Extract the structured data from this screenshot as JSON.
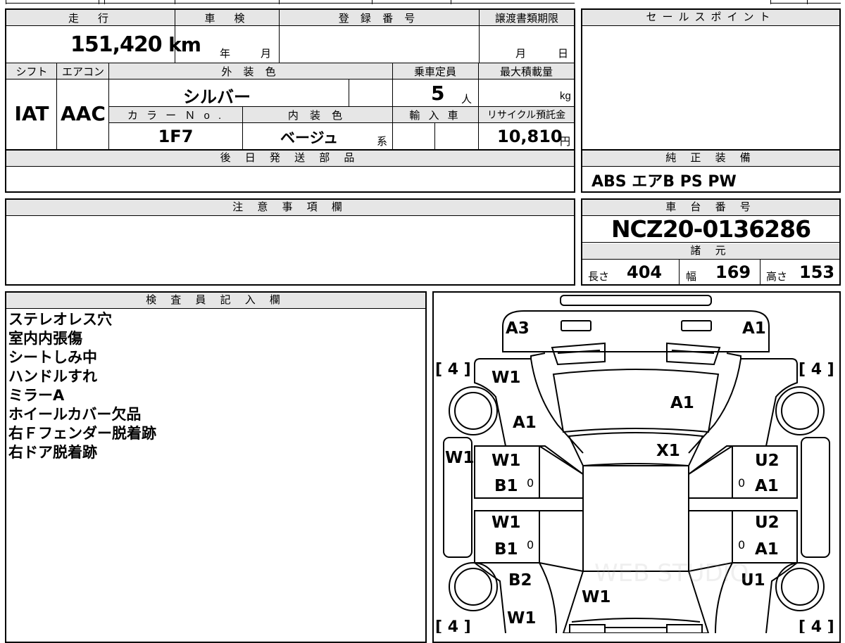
{
  "top_fields": {
    "mileage_label": "走　行",
    "mileage_value": "151,420",
    "mileage_unit": "km",
    "inspection_label": "車　検",
    "inspection_year": "年",
    "inspection_month": "月",
    "registration_label": "登 録 番 号",
    "transfer_label": "譲渡書類期限",
    "transfer_month": "月",
    "transfer_day": "日"
  },
  "row2": {
    "shift_label": "シフト",
    "shift_value": "IAT",
    "aircon_label": "エアコン",
    "aircon_value": "AAC",
    "exterior_label": "外 装 色",
    "exterior_value": "シルバー",
    "capacity_label": "乗車定員",
    "capacity_value": "5",
    "capacity_unit": "人",
    "load_label": "最大積載量",
    "load_unit": "kg",
    "color_no_label": "カ ラ ー Ｎ o .",
    "color_no_value": "1F7",
    "interior_label": "内 装 色",
    "interior_value": "ベージュ",
    "interior_suffix": "系",
    "import_label": "輸 入 車",
    "recycle_label": "リサイクル預託金",
    "recycle_value": "10,810",
    "recycle_unit": "円"
  },
  "later_parts": {
    "label": "後 日 発 送 部 品",
    "value": ""
  },
  "sales_point": {
    "label": "セールスポイント",
    "value": ""
  },
  "genuine_equipment": {
    "label": "純 正 装 備",
    "value": "ABS エアB PS PW"
  },
  "caution": {
    "label": "注 意 事 項 欄",
    "value": ""
  },
  "chassis": {
    "label": "車 台 番 号",
    "value": "NCZ20-0136286"
  },
  "specs": {
    "label": "諸 元",
    "length_label": "長さ",
    "length_value": "404",
    "width_label": "幅",
    "width_value": "169",
    "height_label": "高さ",
    "height_value": "153"
  },
  "inspector": {
    "label": "検 査 員 記 入 欄",
    "notes": [
      "ステレオレス穴",
      "室内内張傷",
      "シートしみ中",
      "ハンドルすれ",
      "ミラーA",
      "ホイールカバー欠品",
      "右Ｆフェンダー脱着跡",
      "右ドア脱着跡"
    ]
  },
  "diagram": {
    "tire_labels": [
      "[ 4 ]",
      "[ 4 ]",
      "[ 4 ]",
      "[ 4 ]"
    ],
    "damage": {
      "front_left_corner": "A3",
      "front_right_corner": "A1",
      "left_front_fender_upper": "W1",
      "left_front_fender_lower": "A1",
      "hood": "A1",
      "windshield": "X1",
      "left_side_panel": "W1",
      "left_front_door_1": "W1",
      "left_front_door_2": "B1",
      "left_rear_door_1": "W1",
      "left_rear_door_2": "B1",
      "right_front_door_1": "U2",
      "right_front_door_2": "A1",
      "right_rear_door_1": "U2",
      "right_rear_door_2": "A1",
      "left_rear_fender": "B2",
      "right_rear_fender": "U1",
      "tailgate": "W1",
      "left_rear_bottom": "W1",
      "left_zero_1": "0",
      "left_zero_2": "0",
      "right_zero_1": "0",
      "right_zero_2": "0"
    },
    "watermark": "WEB STUDIO"
  }
}
